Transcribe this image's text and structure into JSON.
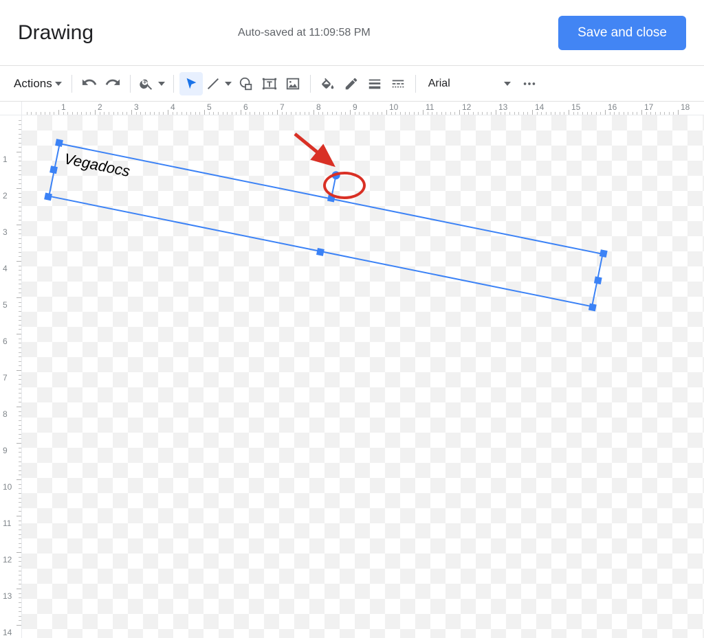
{
  "header": {
    "title": "Drawing",
    "autosave": "Auto-saved at 11:09:58 PM",
    "save_button": "Save and close"
  },
  "toolbar": {
    "actions_label": "Actions",
    "font_name": "Arial"
  },
  "canvas": {
    "textbox_text": "Vegadocs"
  },
  "rulers": {
    "horizontal": [
      1,
      2,
      3,
      4,
      5,
      6,
      7,
      8,
      9,
      10,
      11,
      12,
      13,
      14,
      15,
      16,
      17,
      18
    ],
    "vertical": [
      1,
      2,
      3,
      4,
      5,
      6,
      7,
      8,
      9,
      10,
      11,
      12,
      13,
      14
    ]
  },
  "colors": {
    "accent": "#1a73e8",
    "selection": "#3b82f6",
    "primary_button": "#4285f4",
    "annotation": "#d93025"
  }
}
